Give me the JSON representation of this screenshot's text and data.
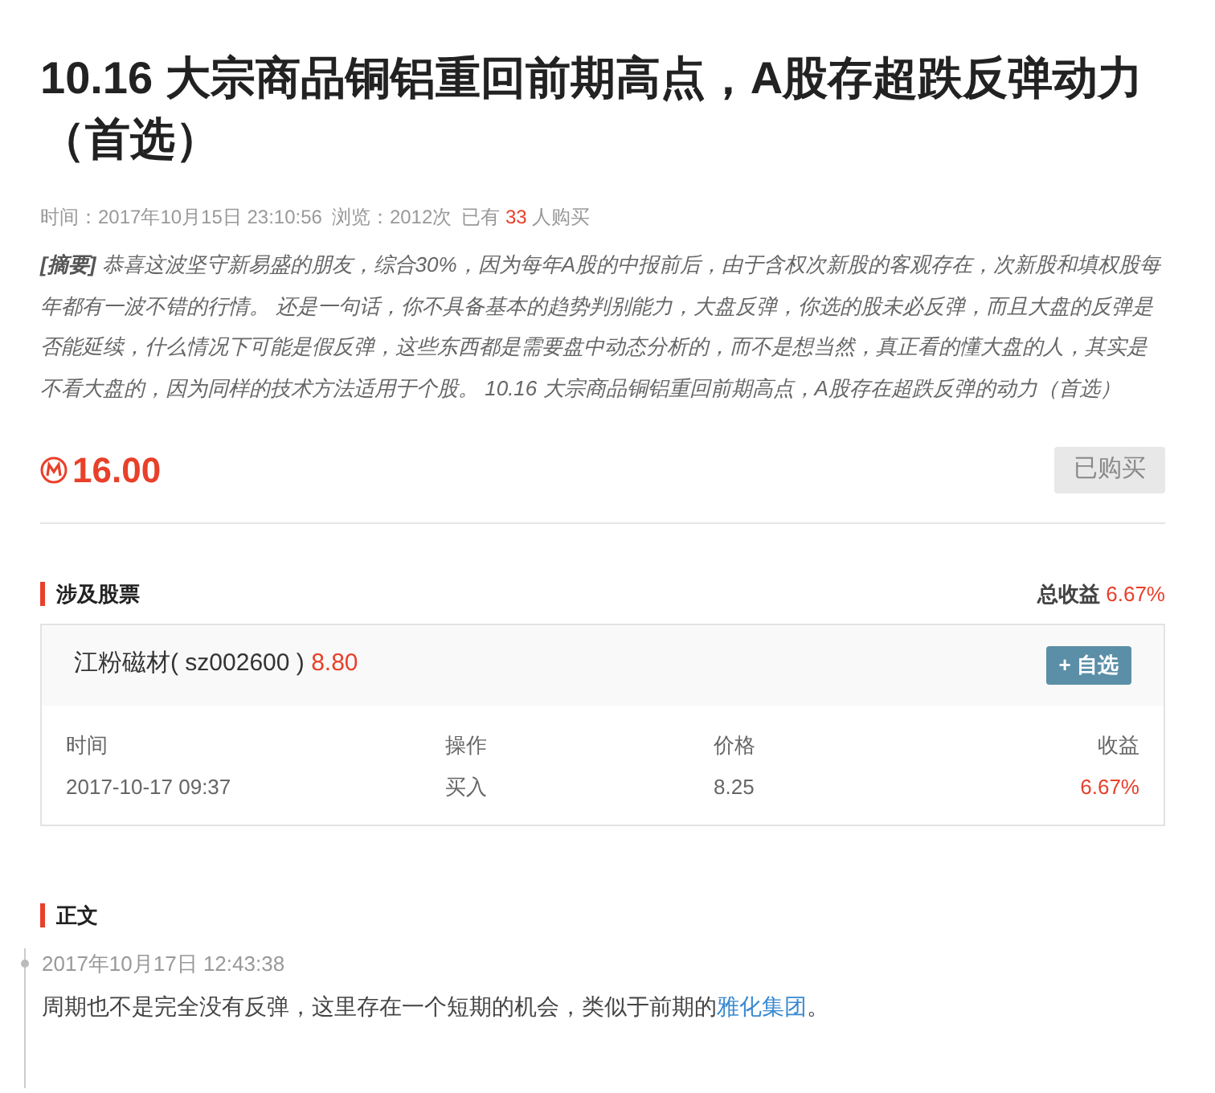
{
  "article": {
    "title": "10.16 大宗商品铜铝重回前期高点，A股存超跌反弹动力（首选）",
    "meta": {
      "time": "时间：2017年10月15日 23:10:56",
      "views": "浏览：2012次",
      "buyers_prefix": "已有",
      "buyers_count": "33",
      "buyers_suffix": "人购买"
    },
    "summary_label": "[摘要]",
    "summary": "恭喜这波坚守新易盛的朋友，综合30%，因为每年A股的中报前后，由于含权次新股的客观存在，次新股和填权股每年都有一波不错的行情。 还是一句话，你不具备基本的趋势判别能力，大盘反弹，你选的股未必反弹，而且大盘的反弹是否能延续，什么情况下可能是假反弹，这些东西都是需要盘中动态分析的，而不是想当然，真正看的懂大盘的人，其实是不看大盘的，因为同样的技术方法适用于个股。 10.16 大宗商品铜铝重回前期高点，A股存在超跌反弹的动力（首选）",
    "price": "16.00",
    "buy_button": {
      "label": "已购买",
      "disabled": true
    }
  },
  "stocks_section": {
    "title": "涉及股票",
    "total_label": "总收益",
    "total_value": "6.67%",
    "stocks": [
      {
        "name": "江粉磁材( sz002600 )",
        "price": "8.80",
        "watch_button": "+ 自选",
        "columns": [
          "时间",
          "操作",
          "价格",
          "收益"
        ],
        "rows": [
          {
            "cells": [
              "2017-10-17 09:37",
              "买入",
              "8.25",
              "6.67%"
            ]
          }
        ]
      }
    ]
  },
  "body_section": {
    "title": "正文",
    "entries": [
      {
        "time": "2017年10月17日 12:43:38",
        "text": "周期也不是完全没有反弹，这里存在一个短期的机会，类似于前期的",
        "link": "雅化集团",
        "text_end": "。"
      }
    ]
  }
}
